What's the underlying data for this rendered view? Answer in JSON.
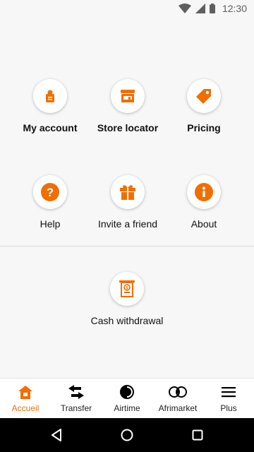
{
  "status_bar": {
    "time": "12:30"
  },
  "colors": {
    "accent": "#f16e00",
    "nav_bar": "#000000"
  },
  "grid": {
    "row1": [
      {
        "label": "My account",
        "icon": "person-card-icon"
      },
      {
        "label": "Store locator",
        "icon": "store-icon"
      },
      {
        "label": "Pricing",
        "icon": "price-tag-icon"
      }
    ],
    "row2": [
      {
        "label": "Help",
        "icon": "question-icon"
      },
      {
        "label": "Invite a friend",
        "icon": "gift-icon"
      },
      {
        "label": "About",
        "icon": "info-icon"
      }
    ],
    "row3": [
      {
        "label": "Cash withdrawal",
        "icon": "cash-withdrawal-icon"
      }
    ]
  },
  "bottom_nav": {
    "items": [
      {
        "label": "Accueil",
        "icon": "home-icon",
        "active": true
      },
      {
        "label": "Transfer",
        "icon": "transfer-arrows-icon",
        "active": false
      },
      {
        "label": "Airtime",
        "icon": "airtime-icon",
        "active": false
      },
      {
        "label": "Afrimarket",
        "icon": "afrimarket-icon",
        "active": false
      },
      {
        "label": "Plus",
        "icon": "menu-icon",
        "active": false
      }
    ]
  }
}
